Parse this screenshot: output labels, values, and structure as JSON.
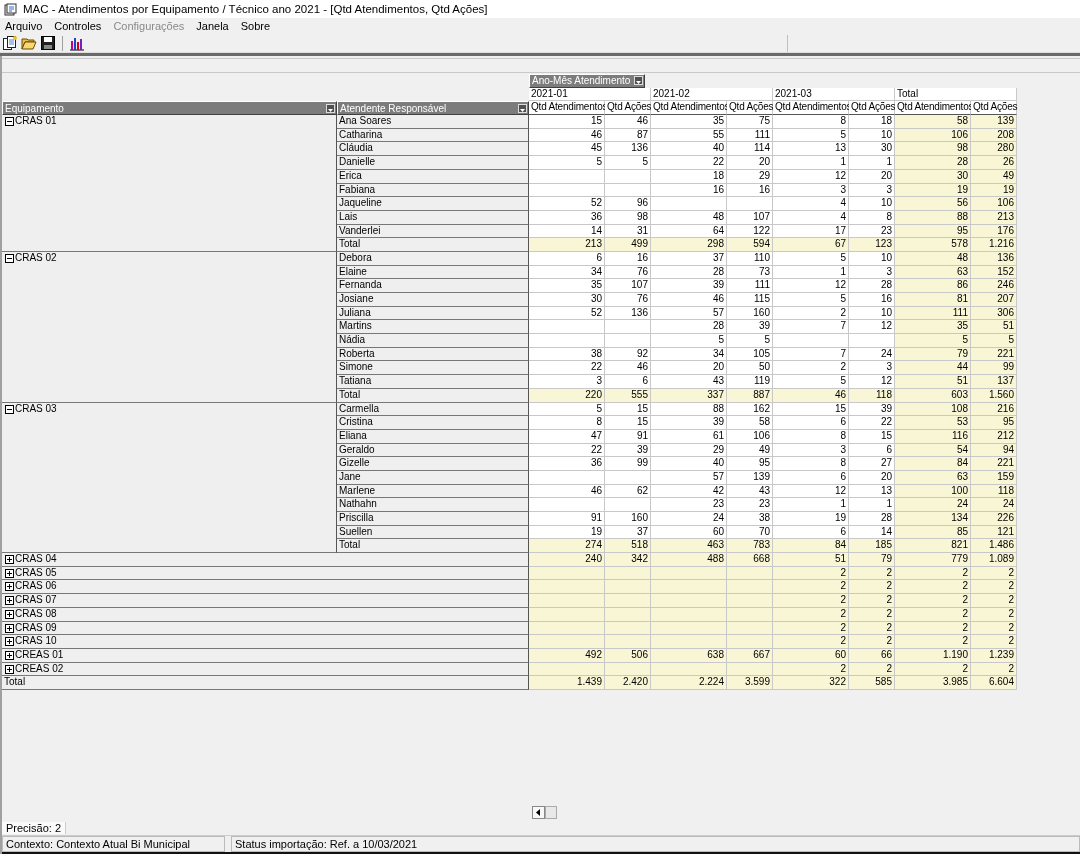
{
  "window": {
    "title": "MAC - Atendimentos por Equipamento / Técnico ano 2021 - [Qtd Atendimentos, Qtd Ações]"
  },
  "menu": [
    {
      "label": "Arquivo",
      "disabled": false
    },
    {
      "label": "Controles",
      "disabled": false
    },
    {
      "label": "Configurações",
      "disabled": true
    },
    {
      "label": "Janela",
      "disabled": false
    },
    {
      "label": "Sobre",
      "disabled": false
    }
  ],
  "pivot": {
    "column_field": "Ano-Mês Atendimento",
    "row_fields": [
      "Equipamento",
      "Atendente Responsável"
    ],
    "column_groups": [
      {
        "label": "2021-01",
        "kind": "period",
        "measures": [
          "Qtd Atendimentos",
          "Qtd Ações"
        ]
      },
      {
        "label": "2021-02",
        "kind": "period",
        "measures": [
          "Qtd Atendimentos",
          "Qtd Ações"
        ]
      },
      {
        "label": "2021-03",
        "kind": "period",
        "measures": [
          "Qtd Atendimentos",
          "Qtd Ações"
        ]
      },
      {
        "label": "Total",
        "kind": "total",
        "measures": [
          "Qtd Atendimentos",
          "Qtd Ações"
        ]
      }
    ],
    "groups": [
      {
        "name": "CRAS 01",
        "expanded": true,
        "rows": [
          {
            "name": "Ana Soares",
            "values": {
              "col_1": "15",
              "col_2": "46",
              "col_3": "35",
              "col_4": "75",
              "col_5": "8",
              "col_6": "18",
              "col_7": "58",
              "col_8": "139"
            }
          },
          {
            "name": "Catharina",
            "values": {
              "col_1": "46",
              "col_2": "87",
              "col_3": "55",
              "col_4": "111",
              "col_5": "5",
              "col_6": "10",
              "col_7": "106",
              "col_8": "208"
            }
          },
          {
            "name": "Cláudia",
            "values": {
              "col_1": "45",
              "col_2": "136",
              "col_3": "40",
              "col_4": "114",
              "col_5": "13",
              "col_6": "30",
              "col_7": "98",
              "col_8": "280"
            }
          },
          {
            "name": "Danielle",
            "values": {
              "col_1": "5",
              "col_2": "5",
              "col_3": "22",
              "col_4": "20",
              "col_5": "1",
              "col_6": "1",
              "col_7": "28",
              "col_8": "26"
            }
          },
          {
            "name": "Erica",
            "values": {
              "col_3": "18",
              "col_4": "29",
              "col_5": "12",
              "col_6": "20",
              "col_7": "30",
              "col_8": "49"
            }
          },
          {
            "name": "Fabiana",
            "values": {
              "col_3": "16",
              "col_4": "16",
              "col_5": "3",
              "col_6": "3",
              "col_7": "19",
              "col_8": "19"
            }
          },
          {
            "name": "Jaqueline",
            "values": {
              "col_1": "52",
              "col_2": "96",
              "col_5": "4",
              "col_6": "10",
              "col_7": "56",
              "col_8": "106"
            }
          },
          {
            "name": "Lais",
            "values": {
              "col_1": "36",
              "col_2": "98",
              "col_3": "48",
              "col_4": "107",
              "col_5": "4",
              "col_6": "8",
              "col_7": "88",
              "col_8": "213"
            }
          },
          {
            "name": "Vanderlei",
            "values": {
              "col_1": "14",
              "col_2": "31",
              "col_3": "64",
              "col_4": "122",
              "col_5": "17",
              "col_6": "23",
              "col_7": "95",
              "col_8": "176"
            }
          }
        ],
        "total": {
          "label": "Total",
          "values": {
            "col_1": "213",
            "col_2": "499",
            "col_3": "298",
            "col_4": "594",
            "col_5": "67",
            "col_6": "123",
            "col_7": "578",
            "col_8": "1.216"
          }
        }
      },
      {
        "name": "CRAS 02",
        "expanded": true,
        "rows": [
          {
            "name": "Debora",
            "values": {
              "col_1": "6",
              "col_2": "16",
              "col_3": "37",
              "col_4": "110",
              "col_5": "5",
              "col_6": "10",
              "col_7": "48",
              "col_8": "136"
            }
          },
          {
            "name": "Elaine",
            "values": {
              "col_1": "34",
              "col_2": "76",
              "col_3": "28",
              "col_4": "73",
              "col_5": "1",
              "col_6": "3",
              "col_7": "63",
              "col_8": "152"
            }
          },
          {
            "name": "Fernanda",
            "values": {
              "col_1": "35",
              "col_2": "107",
              "col_3": "39",
              "col_4": "111",
              "col_5": "12",
              "col_6": "28",
              "col_7": "86",
              "col_8": "246"
            }
          },
          {
            "name": "Josiane",
            "values": {
              "col_1": "30",
              "col_2": "76",
              "col_3": "46",
              "col_4": "115",
              "col_5": "5",
              "col_6": "16",
              "col_7": "81",
              "col_8": "207"
            }
          },
          {
            "name": "Juliana",
            "values": {
              "col_1": "52",
              "col_2": "136",
              "col_3": "57",
              "col_4": "160",
              "col_5": "2",
              "col_6": "10",
              "col_7": "111",
              "col_8": "306"
            }
          },
          {
            "name": "Martins",
            "values": {
              "col_3": "28",
              "col_4": "39",
              "col_5": "7",
              "col_6": "12",
              "col_7": "35",
              "col_8": "51"
            }
          },
          {
            "name": "Nádia",
            "values": {
              "col_3": "5",
              "col_4": "5",
              "col_7": "5",
              "col_8": "5"
            }
          },
          {
            "name": "Roberta",
            "values": {
              "col_1": "38",
              "col_2": "92",
              "col_3": "34",
              "col_4": "105",
              "col_5": "7",
              "col_6": "24",
              "col_7": "79",
              "col_8": "221"
            }
          },
          {
            "name": "Simone",
            "values": {
              "col_1": "22",
              "col_2": "46",
              "col_3": "20",
              "col_4": "50",
              "col_5": "2",
              "col_6": "3",
              "col_7": "44",
              "col_8": "99"
            }
          },
          {
            "name": "Tatiana",
            "values": {
              "col_1": "3",
              "col_2": "6",
              "col_3": "43",
              "col_4": "119",
              "col_5": "5",
              "col_6": "12",
              "col_7": "51",
              "col_8": "137"
            }
          }
        ],
        "total": {
          "label": "Total",
          "values": {
            "col_1": "220",
            "col_2": "555",
            "col_3": "337",
            "col_4": "887",
            "col_5": "46",
            "col_6": "118",
            "col_7": "603",
            "col_8": "1.560"
          }
        }
      },
      {
        "name": "CRAS 03",
        "expanded": true,
        "rows": [
          {
            "name": "Carmella",
            "values": {
              "col_1": "5",
              "col_2": "15",
              "col_3": "88",
              "col_4": "162",
              "col_5": "15",
              "col_6": "39",
              "col_7": "108",
              "col_8": "216"
            }
          },
          {
            "name": "Cristina",
            "values": {
              "col_1": "8",
              "col_2": "15",
              "col_3": "39",
              "col_4": "58",
              "col_5": "6",
              "col_6": "22",
              "col_7": "53",
              "col_8": "95"
            }
          },
          {
            "name": "Eliana",
            "values": {
              "col_1": "47",
              "col_2": "91",
              "col_3": "61",
              "col_4": "106",
              "col_5": "8",
              "col_6": "15",
              "col_7": "116",
              "col_8": "212"
            }
          },
          {
            "name": "Geraldo",
            "values": {
              "col_1": "22",
              "col_2": "39",
              "col_3": "29",
              "col_4": "49",
              "col_5": "3",
              "col_6": "6",
              "col_7": "54",
              "col_8": "94"
            }
          },
          {
            "name": "Gizelle",
            "values": {
              "col_1": "36",
              "col_2": "99",
              "col_3": "40",
              "col_4": "95",
              "col_5": "8",
              "col_6": "27",
              "col_7": "84",
              "col_8": "221"
            }
          },
          {
            "name": "Jane",
            "values": {
              "col_3": "57",
              "col_4": "139",
              "col_5": "6",
              "col_6": "20",
              "col_7": "63",
              "col_8": "159"
            }
          },
          {
            "name": "Marlene",
            "values": {
              "col_1": "46",
              "col_2": "62",
              "col_3": "42",
              "col_4": "43",
              "col_5": "12",
              "col_6": "13",
              "col_7": "100",
              "col_8": "118"
            }
          },
          {
            "name": "Nathahn",
            "values": {
              "col_3": "23",
              "col_4": "23",
              "col_5": "1",
              "col_6": "1",
              "col_7": "24",
              "col_8": "24"
            }
          },
          {
            "name": "Priscilla",
            "values": {
              "col_1": "91",
              "col_2": "160",
              "col_3": "24",
              "col_4": "38",
              "col_5": "19",
              "col_6": "28",
              "col_7": "134",
              "col_8": "226"
            }
          },
          {
            "name": "Suellen",
            "values": {
              "col_1": "19",
              "col_2": "37",
              "col_3": "60",
              "col_4": "70",
              "col_5": "6",
              "col_6": "14",
              "col_7": "85",
              "col_8": "121"
            }
          }
        ],
        "total": {
          "label": "Total",
          "values": {
            "col_1": "274",
            "col_2": "518",
            "col_3": "463",
            "col_4": "783",
            "col_5": "84",
            "col_6": "185",
            "col_7": "821",
            "col_8": "1.486"
          }
        }
      },
      {
        "name": "CRAS 04",
        "expanded": false,
        "values": {
          "col_1": "240",
          "col_2": "342",
          "col_3": "488",
          "col_4": "668",
          "col_5": "51",
          "col_6": "79",
          "col_7": "779",
          "col_8": "1.089"
        }
      },
      {
        "name": "CRAS 05",
        "expanded": false,
        "values": {
          "col_5": "2",
          "col_6": "2",
          "col_7": "2",
          "col_8": "2"
        }
      },
      {
        "name": "CRAS 06",
        "expanded": false,
        "values": {
          "col_5": "2",
          "col_6": "2",
          "col_7": "2",
          "col_8": "2"
        }
      },
      {
        "name": "CRAS 07",
        "expanded": false,
        "values": {
          "col_5": "2",
          "col_6": "2",
          "col_7": "2",
          "col_8": "2"
        }
      },
      {
        "name": "CRAS 08",
        "expanded": false,
        "values": {
          "col_5": "2",
          "col_6": "2",
          "col_7": "2",
          "col_8": "2"
        }
      },
      {
        "name": "CRAS 09",
        "expanded": false,
        "values": {
          "col_5": "2",
          "col_6": "2",
          "col_7": "2",
          "col_8": "2"
        }
      },
      {
        "name": "CRAS 10",
        "expanded": false,
        "values": {
          "col_5": "2",
          "col_6": "2",
          "col_7": "2",
          "col_8": "2"
        }
      },
      {
        "name": "CREAS 01",
        "expanded": false,
        "values": {
          "col_1": "492",
          "col_2": "506",
          "col_3": "638",
          "col_4": "667",
          "col_5": "60",
          "col_6": "66",
          "col_7": "1.190",
          "col_8": "1.239"
        }
      },
      {
        "name": "CREAS 02",
        "expanded": false,
        "values": {
          "col_5": "2",
          "col_6": "2",
          "col_7": "2",
          "col_8": "2"
        }
      }
    ],
    "grand_total": {
      "label": "Total",
      "values": {
        "col_1": "1.439",
        "col_2": "2.420",
        "col_3": "2.224",
        "col_4": "3.599",
        "col_5": "322",
        "col_6": "585",
        "col_7": "3.985",
        "col_8": "6.604"
      }
    }
  },
  "precision": "Precisão: 2",
  "status_bar": [
    "Contexto: Contexto Atual Bi Municipal",
    "Status importação: Ref. a 10/03/2021"
  ]
}
